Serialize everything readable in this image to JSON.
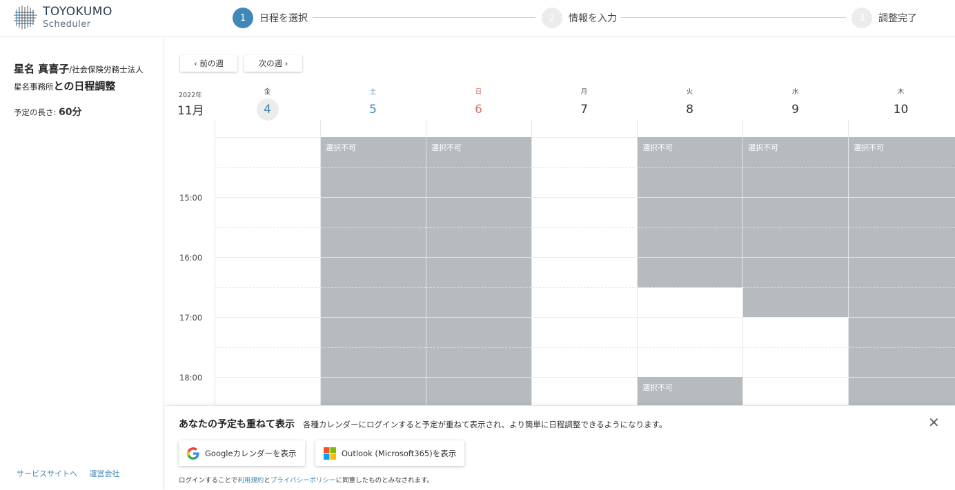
{
  "header": {
    "logo": {
      "name": "TOYOKUMO",
      "sub": "Scheduler"
    },
    "steps": [
      {
        "num": "1",
        "label": "日程を選択"
      },
      {
        "num": "2",
        "label": "情報を入力"
      },
      {
        "num": "3",
        "label": "調整完了"
      }
    ],
    "active_color": "#3f88b8"
  },
  "sidebar": {
    "title": {
      "name": "星名 真喜子",
      "org_a": "/社会保険労務士法人",
      "org_b": "星名事務所",
      "suffix": "との日程調整"
    },
    "duration_label": "予定の長さ:",
    "duration_value": "60分",
    "links": {
      "service": "サービスサイトへ",
      "company": "運営会社"
    }
  },
  "week_nav": {
    "prev": "前の週",
    "next": "次の週"
  },
  "calendar": {
    "year": "2022年",
    "month": "11月",
    "days": [
      {
        "dow": "金",
        "num": "4"
      },
      {
        "dow": "土",
        "num": "5"
      },
      {
        "dow": "日",
        "num": "6"
      },
      {
        "dow": "月",
        "num": "7"
      },
      {
        "dow": "火",
        "num": "8"
      },
      {
        "dow": "水",
        "num": "9"
      },
      {
        "dow": "木",
        "num": "10"
      }
    ],
    "times": [
      "15:00",
      "16:00",
      "17:00",
      "18:00"
    ],
    "unavailable_label": "選択不可",
    "unavailable_color": "#b5bbbf"
  },
  "panel": {
    "title": "あなたの予定も重ねて表示",
    "desc": "各種カレンダーにログインすると予定が重ねて表示され、より簡単に日程調整できるようになります。",
    "close": "✕",
    "google": "Googleカレンダーを表示",
    "outlook": "Outlook (Microsoft365)を表示",
    "note_a": "ログインすることで",
    "note_terms": "利用規約",
    "note_and": "と",
    "note_privacy": "プライバシーポリシー",
    "note_b": "に同意したものとみなされます。"
  }
}
